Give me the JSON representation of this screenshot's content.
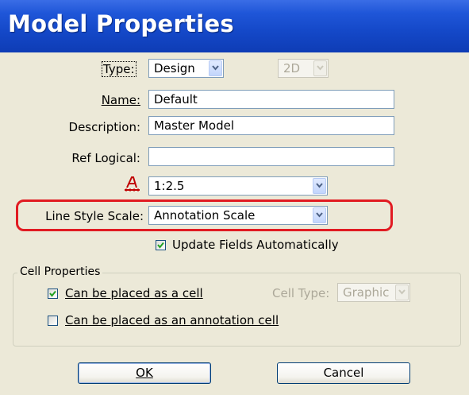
{
  "window": {
    "title": "Model Properties"
  },
  "form": {
    "type": {
      "label": "Type:",
      "value": "Design"
    },
    "dimension": {
      "value": "2D"
    },
    "name": {
      "label": "Name:",
      "value": "Default"
    },
    "description": {
      "label": "Description:",
      "value": "Master Model"
    },
    "ref_logical": {
      "label": "Ref Logical:",
      "value": ""
    },
    "annotation_scale": {
      "icon": "annotation-scale-icon",
      "value": "1:2.5"
    },
    "line_style_scale": {
      "label": "Line Style Scale:",
      "value": "Annotation Scale"
    },
    "update_fields": {
      "label": "Update Fields Automatically",
      "checked": true
    }
  },
  "cell_properties": {
    "legend": "Cell Properties",
    "placed_as_cell": {
      "label": "Can be placed as a cell",
      "checked": true
    },
    "cell_type": {
      "label": "Cell Type:",
      "value": "Graphic"
    },
    "placed_as_annotation": {
      "label": "Can be placed as an annotation cell",
      "checked": false
    }
  },
  "buttons": {
    "ok": "OK",
    "cancel": "Cancel"
  },
  "colors": {
    "title_bar": "#1448c8",
    "highlight_outline": "#e11b22",
    "dialog_bg": "#ece9d8"
  }
}
